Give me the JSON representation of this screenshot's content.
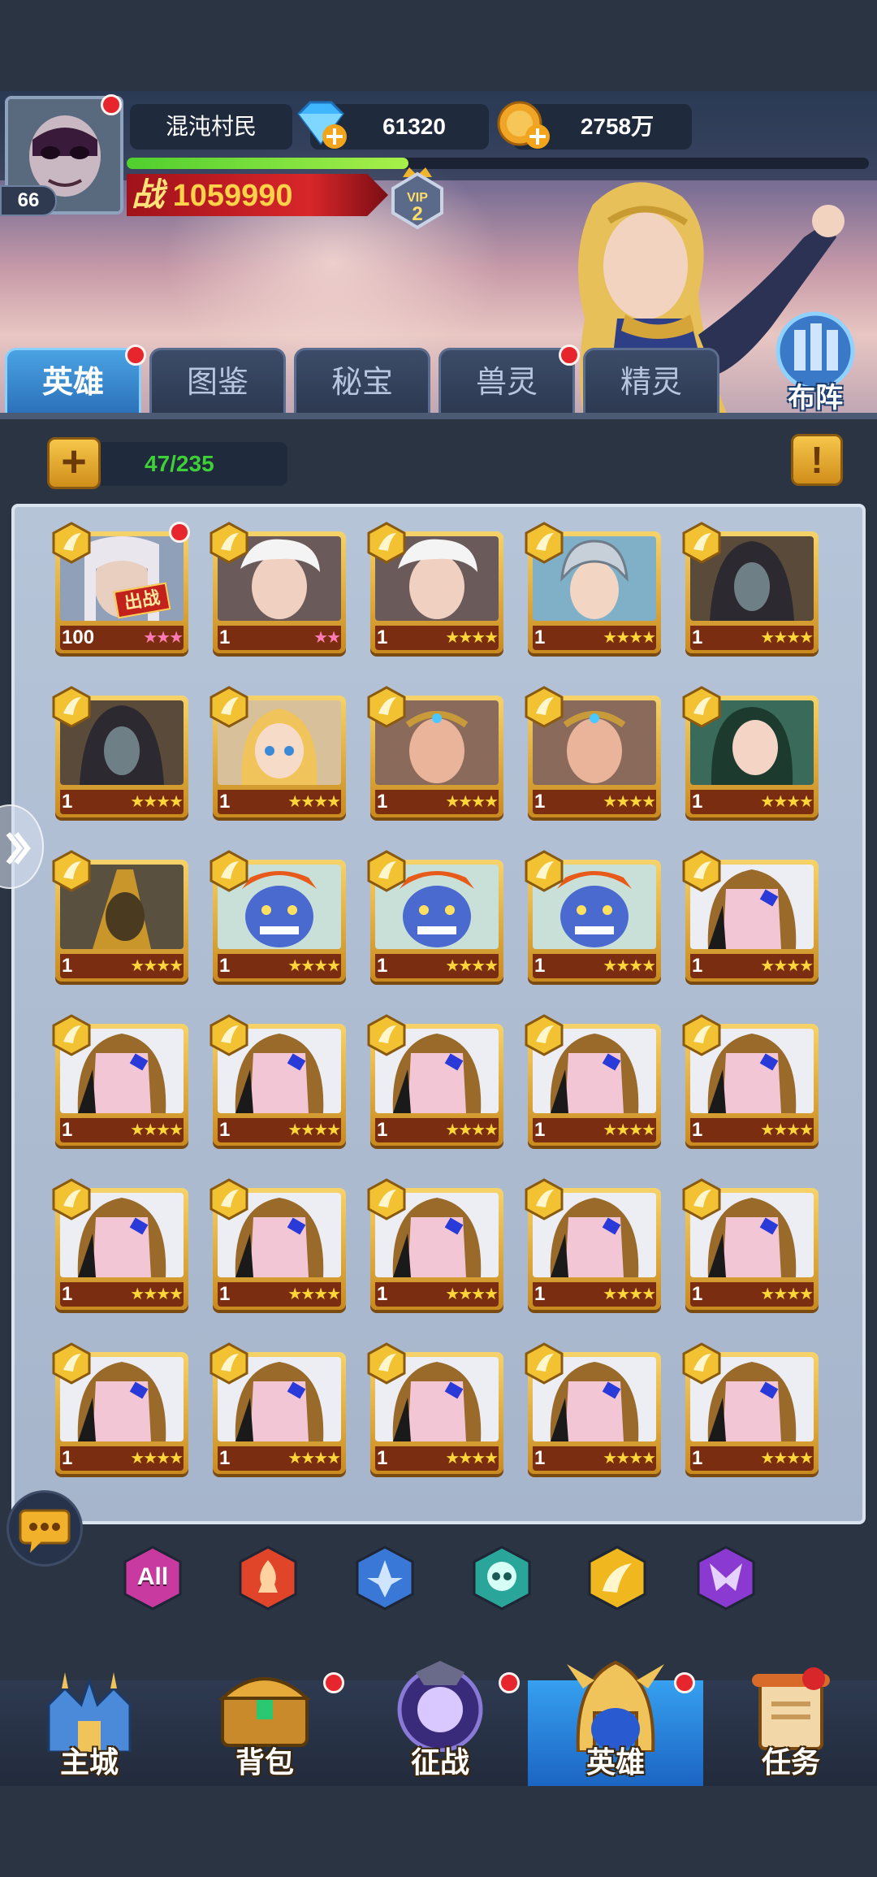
{
  "player": {
    "name": "混沌村民",
    "level": "66",
    "diamonds": "61320",
    "gold": "2758万",
    "exp_progress": 0.38,
    "power": "1059990",
    "power_prefix": "战",
    "vip": "2"
  },
  "tabs": [
    {
      "label": "英雄",
      "active": true,
      "badge": true
    },
    {
      "label": "图鉴",
      "active": false,
      "badge": false
    },
    {
      "label": "秘宝",
      "active": false,
      "badge": false
    },
    {
      "label": "兽灵",
      "active": false,
      "badge": true
    },
    {
      "label": "精灵",
      "active": false,
      "badge": false
    }
  ],
  "formation_label": "布阵",
  "capacity": "47/235",
  "info_glyph": "!",
  "plus_glyph": "+",
  "heroes": [
    {
      "level": "100",
      "stars": 3,
      "star_color": "pink",
      "portrait": "elder",
      "deployed": true,
      "badge": true
    },
    {
      "level": "1",
      "stars": 2,
      "star_color": "pink",
      "portrait": "whitehair",
      "deployed": false,
      "badge": false
    },
    {
      "level": "1",
      "stars": 4,
      "star_color": "gold",
      "portrait": "whitehair",
      "deployed": false,
      "badge": false
    },
    {
      "level": "1",
      "stars": 4,
      "star_color": "gold",
      "portrait": "helmet",
      "deployed": false,
      "badge": false
    },
    {
      "level": "1",
      "stars": 4,
      "star_color": "gold",
      "portrait": "hooded",
      "deployed": false,
      "badge": false
    },
    {
      "level": "1",
      "stars": 4,
      "star_color": "gold",
      "portrait": "hooded",
      "deployed": false,
      "badge": false
    },
    {
      "level": "1",
      "stars": 4,
      "star_color": "gold",
      "portrait": "blonde",
      "deployed": false,
      "badge": false
    },
    {
      "level": "1",
      "stars": 4,
      "star_color": "gold",
      "portrait": "elf",
      "deployed": false,
      "badge": false
    },
    {
      "level": "1",
      "stars": 4,
      "star_color": "gold",
      "portrait": "elf",
      "deployed": false,
      "badge": false
    },
    {
      "level": "1",
      "stars": 4,
      "star_color": "gold",
      "portrait": "darkhair",
      "deployed": false,
      "badge": false
    },
    {
      "level": "1",
      "stars": 4,
      "star_color": "gold",
      "portrait": "anubis",
      "deployed": false,
      "badge": false
    },
    {
      "level": "1",
      "stars": 4,
      "star_color": "gold",
      "portrait": "troll",
      "deployed": false,
      "badge": false
    },
    {
      "level": "1",
      "stars": 4,
      "star_color": "gold",
      "portrait": "troll",
      "deployed": false,
      "badge": false
    },
    {
      "level": "1",
      "stars": 4,
      "star_color": "gold",
      "portrait": "troll",
      "deployed": false,
      "badge": false
    },
    {
      "level": "1",
      "stars": 4,
      "star_color": "gold",
      "portrait": "mask",
      "deployed": false,
      "badge": false
    },
    {
      "level": "1",
      "stars": 4,
      "star_color": "gold",
      "portrait": "mask",
      "deployed": false,
      "badge": false
    },
    {
      "level": "1",
      "stars": 4,
      "star_color": "gold",
      "portrait": "mask",
      "deployed": false,
      "badge": false
    },
    {
      "level": "1",
      "stars": 4,
      "star_color": "gold",
      "portrait": "mask",
      "deployed": false,
      "badge": false
    },
    {
      "level": "1",
      "stars": 4,
      "star_color": "gold",
      "portrait": "mask",
      "deployed": false,
      "badge": false
    },
    {
      "level": "1",
      "stars": 4,
      "star_color": "gold",
      "portrait": "mask",
      "deployed": false,
      "badge": false
    },
    {
      "level": "1",
      "stars": 4,
      "star_color": "gold",
      "portrait": "mask",
      "deployed": false,
      "badge": false
    },
    {
      "level": "1",
      "stars": 4,
      "star_color": "gold",
      "portrait": "mask",
      "deployed": false,
      "badge": false
    },
    {
      "level": "1",
      "stars": 4,
      "star_color": "gold",
      "portrait": "mask",
      "deployed": false,
      "badge": false
    },
    {
      "level": "1",
      "stars": 4,
      "star_color": "gold",
      "portrait": "mask",
      "deployed": false,
      "badge": false
    },
    {
      "level": "1",
      "stars": 4,
      "star_color": "gold",
      "portrait": "mask",
      "deployed": false,
      "badge": false
    },
    {
      "level": "1",
      "stars": 4,
      "star_color": "gold",
      "portrait": "mask",
      "deployed": false,
      "badge": false
    },
    {
      "level": "1",
      "stars": 4,
      "star_color": "gold",
      "portrait": "mask",
      "deployed": false,
      "badge": false
    },
    {
      "level": "1",
      "stars": 4,
      "star_color": "gold",
      "portrait": "mask",
      "deployed": false,
      "badge": false
    },
    {
      "level": "1",
      "stars": 4,
      "star_color": "gold",
      "portrait": "mask",
      "deployed": false,
      "badge": false
    },
    {
      "level": "1",
      "stars": 4,
      "star_color": "gold",
      "portrait": "mask",
      "deployed": false,
      "badge": false
    }
  ],
  "deploy_label": "出战",
  "filters": [
    {
      "name": "all",
      "label": "All",
      "color": "#c83aa0"
    },
    {
      "name": "fire",
      "color": "#e0452a"
    },
    {
      "name": "water",
      "color": "#3a78d8"
    },
    {
      "name": "skull",
      "color": "#2aa59a"
    },
    {
      "name": "wind",
      "color": "#f0b81e"
    },
    {
      "name": "dark",
      "color": "#8a3ad0"
    }
  ],
  "nav": [
    {
      "label": "主城",
      "icon": "castle-icon",
      "active": false,
      "badge": false
    },
    {
      "label": "背包",
      "icon": "chest-icon",
      "active": false,
      "badge": true
    },
    {
      "label": "征战",
      "icon": "portal-icon",
      "active": false,
      "badge": true
    },
    {
      "label": "英雄",
      "icon": "helmet-icon",
      "active": true,
      "badge": true
    },
    {
      "label": "任务",
      "icon": "scroll-icon",
      "active": false,
      "badge": false
    }
  ]
}
